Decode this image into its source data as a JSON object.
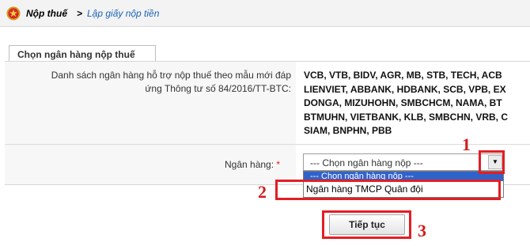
{
  "breadcrumb": {
    "home": "Nộp thuế",
    "separator": ">",
    "current": "Lập giấy nộp tiền"
  },
  "tab": {
    "title": "Chọn ngân hàng nộp thuế"
  },
  "form": {
    "bank_list_label_line1": "Danh sách ngân hàng hỗ trợ nộp thuế theo mẫu mới đáp",
    "bank_list_label_line2": "ứng Thông tư số 84/2016/TT-BTC:",
    "bank_list_lines": [
      "VCB, VTB, BIDV, AGR, MB, STB, TECH, ACB",
      "LIENVIET, ABBANK, HDBANK, SCB, VPB, EX",
      "DONGA, MIZUHOHN, SMBCHCM, NAMA, BT",
      "BTMUHN, VIETBANK, KLB, SMBCHN, VRB, C",
      "SIAM, BNPHN, PBB"
    ],
    "bank_label": "Ngân hàng:",
    "required_mark": "*",
    "bank_select_value": "--- Chọn ngân hàng nộp ---",
    "dropdown_options": [
      "--- Chọn ngân hàng nộp ---",
      "Ngân hàng TMCP Quân đội"
    ],
    "continue_label": "Tiếp tục"
  },
  "annotations": {
    "step1": "1",
    "step2": "2",
    "step3": "3",
    "highlight_color": "#e31e24"
  },
  "icons": {
    "emblem": "national-emblem-icon",
    "dropdown_arrow": "triangle-down-icon"
  }
}
